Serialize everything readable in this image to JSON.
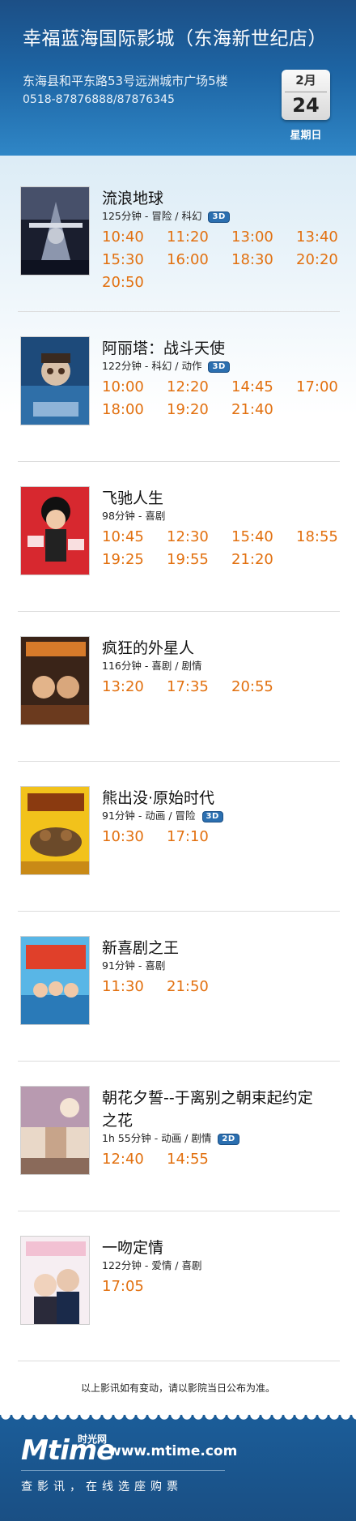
{
  "header": {
    "title": "幸福蓝海国际影城（东海新世纪店）",
    "address": "东海县和平东路53号远洲城市广场5楼",
    "phone": "0518-87876888/87876345",
    "calendar": {
      "month": "2月",
      "day": "24",
      "weekday": "星期日"
    }
  },
  "movies": [
    {
      "title": "流浪地球",
      "info": "125分钟 - 冒险 / 科幻",
      "badge": "3D",
      "times": [
        "10:40",
        "11:20",
        "13:00",
        "13:40",
        "15:30",
        "16:00",
        "18:30",
        "20:20",
        "20:50"
      ]
    },
    {
      "title": "阿丽塔：战斗天使",
      "info": "122分钟 - 科幻 / 动作",
      "badge": "3D",
      "times": [
        "10:00",
        "12:20",
        "14:45",
        "17:00",
        "18:00",
        "19:20",
        "21:40"
      ]
    },
    {
      "title": "飞驰人生",
      "info": "98分钟 - 喜剧",
      "badge": "",
      "times": [
        "10:45",
        "12:30",
        "15:40",
        "18:55",
        "19:25",
        "19:55",
        "21:20"
      ]
    },
    {
      "title": "疯狂的外星人",
      "info": "116分钟 - 喜剧 / 剧情",
      "badge": "",
      "times": [
        "13:20",
        "17:35",
        "20:55"
      ]
    },
    {
      "title": "熊出没·原始时代",
      "info": "91分钟 - 动画 / 冒险",
      "badge": "3D",
      "times": [
        "10:30",
        "17:10"
      ]
    },
    {
      "title": "新喜剧之王",
      "info": "91分钟 - 喜剧",
      "badge": "",
      "times": [
        "11:30",
        "21:50"
      ]
    },
    {
      "title": "朝花夕誓--于离别之朝束起约定",
      "title_line2": "之花",
      "info": "1h 55分钟 - 动画 / 剧情",
      "badge": "2D",
      "times": [
        "12:40",
        "14:55"
      ]
    },
    {
      "title": "一吻定情",
      "info": "122分钟 - 爱情 / 喜剧",
      "badge": "",
      "times": [
        "17:05"
      ]
    }
  ],
  "notice": "以上影讯如有变动，请以影院当日公布为准。",
  "footer": {
    "logo": "Mtime",
    "logo_cn": "时光网",
    "url": "www.mtime.com",
    "slogan": "查影讯，在线选座购票"
  }
}
